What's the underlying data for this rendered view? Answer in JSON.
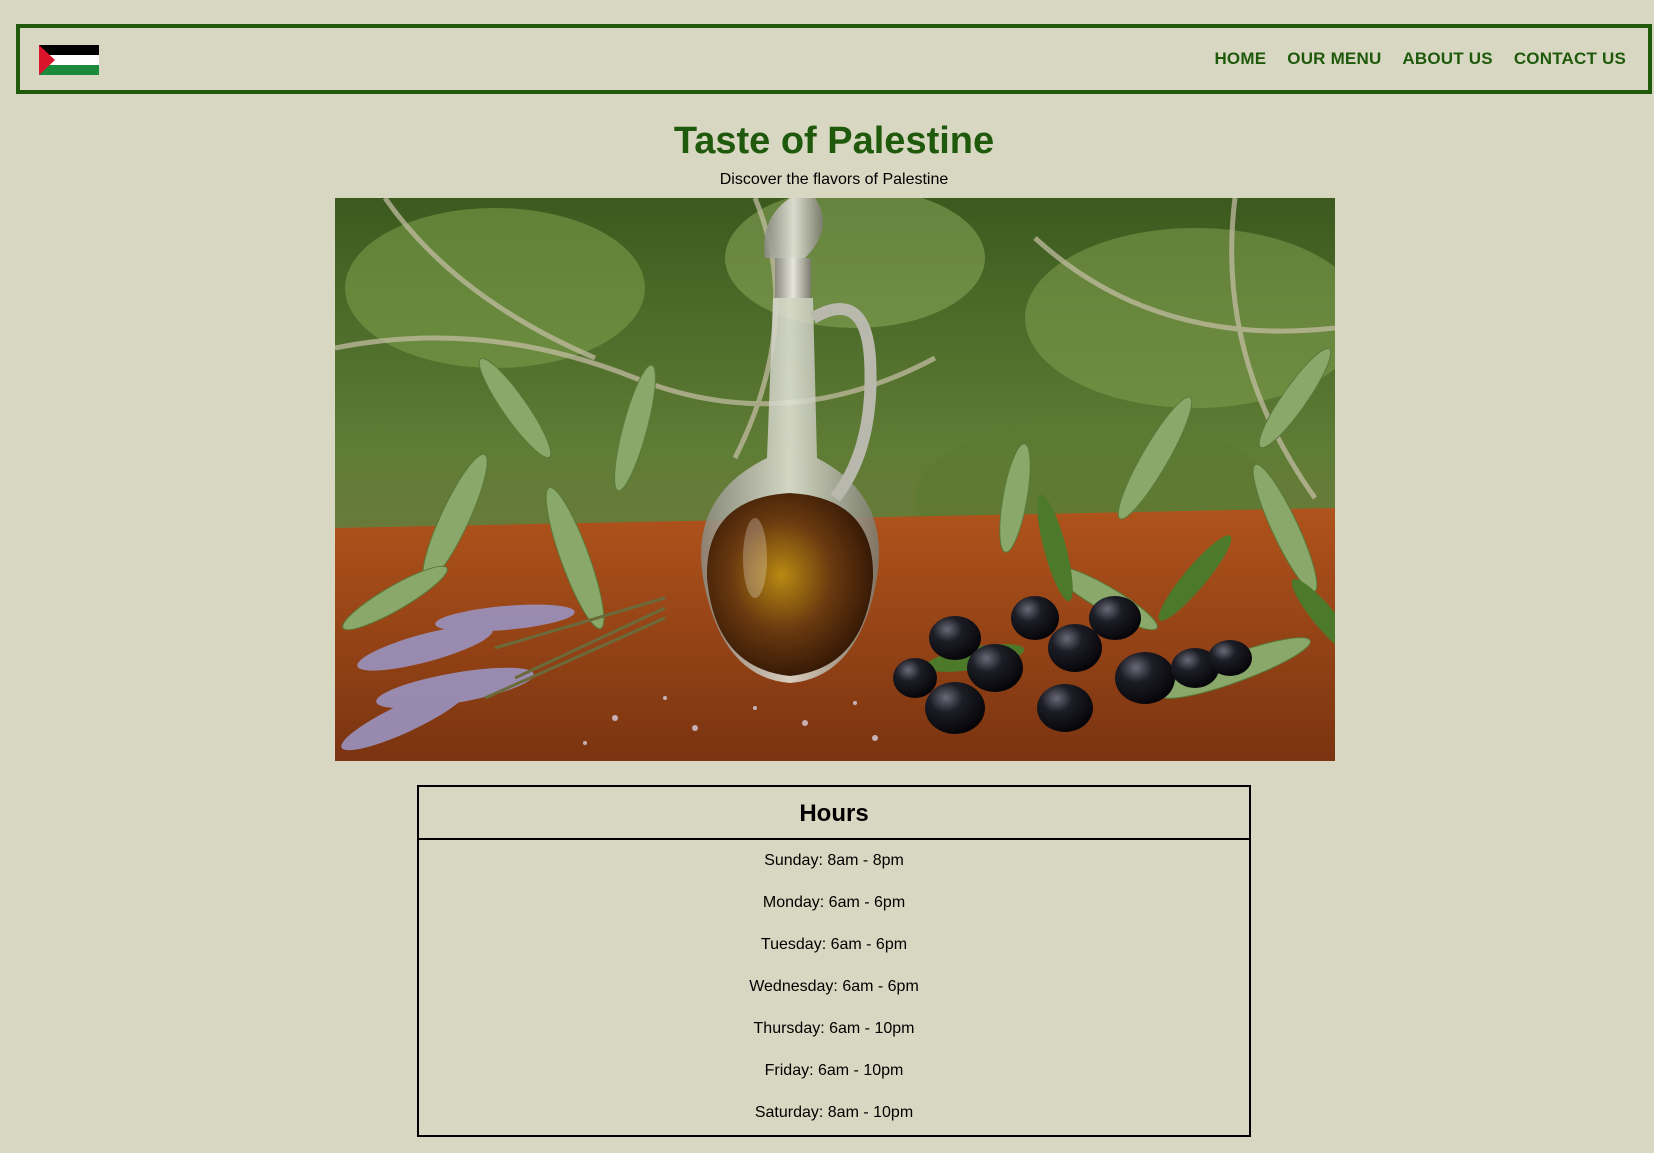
{
  "header": {
    "logo_icon": "palestine-flag-icon",
    "flag_colors": {
      "black": "#000000",
      "white": "#ffffff",
      "green": "#1b8a3b",
      "red": "#d9142b"
    },
    "nav": [
      {
        "label": "HOME"
      },
      {
        "label": "OUR MENU"
      },
      {
        "label": "ABOUT US"
      },
      {
        "label": "CONTACT US"
      }
    ]
  },
  "hero": {
    "title": "Taste of Palestine",
    "subtitle": "Discover the flavors of Palestine",
    "image_icon": "olive-oil-photo"
  },
  "hours": {
    "title": "Hours",
    "items": [
      "Sunday: 8am - 8pm",
      "Monday: 6am - 6pm",
      "Tuesday: 6am - 6pm",
      "Wednesday: 6am - 6pm",
      "Thursday: 6am - 10pm",
      "Friday: 6am - 10pm",
      "Saturday: 8am - 10pm"
    ]
  },
  "colors": {
    "background": "#d8d7c1",
    "accent": "#1f5a0c",
    "text": "#000000"
  }
}
